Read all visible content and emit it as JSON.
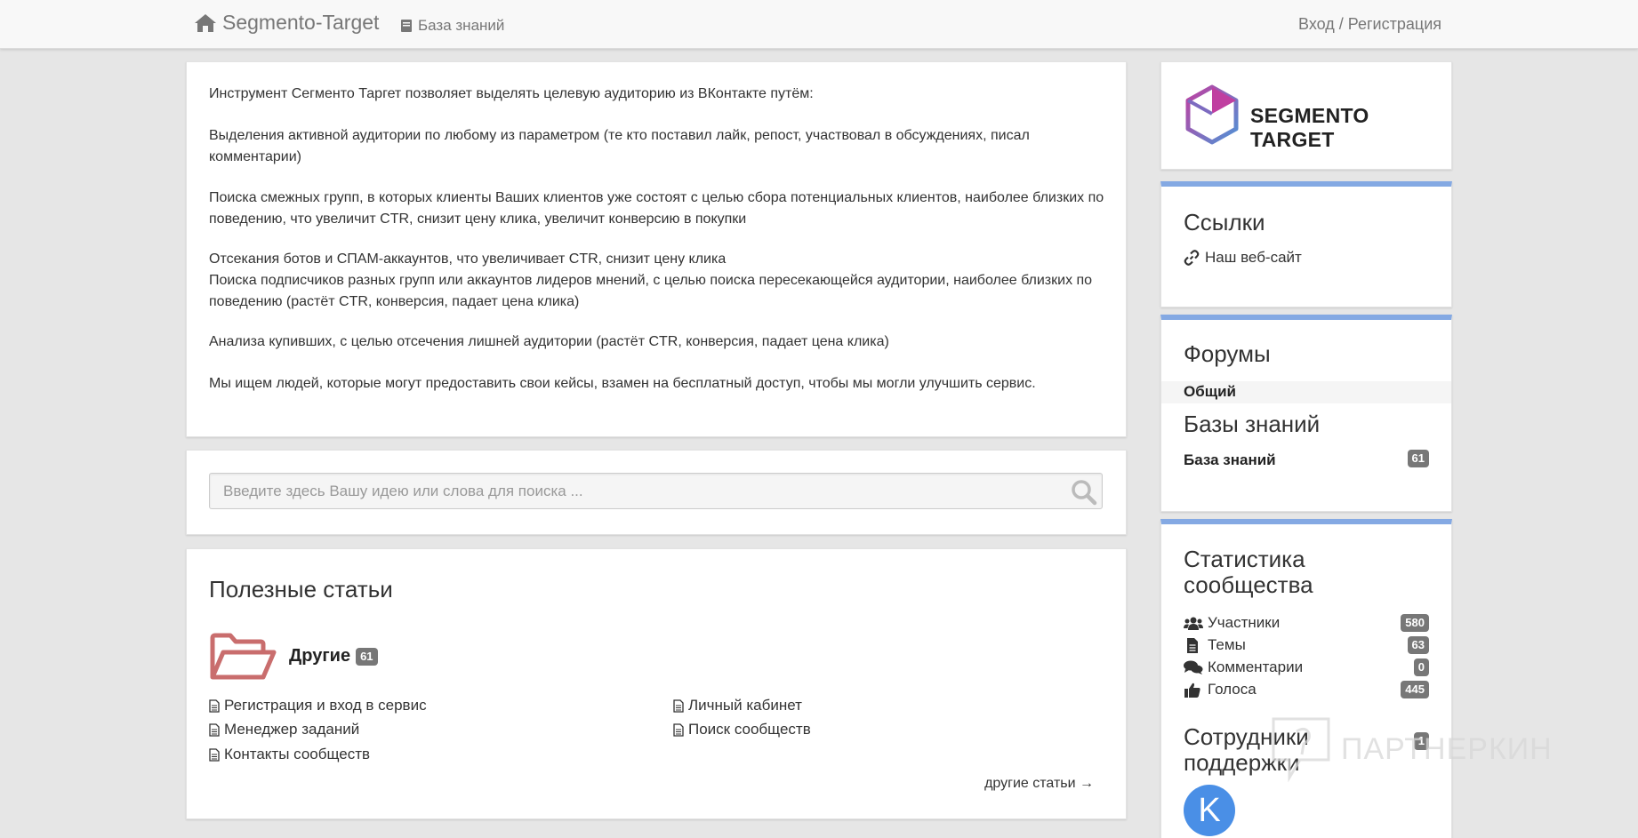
{
  "nav": {
    "brand": "Segmento-Target",
    "kb_link": "База знаний",
    "login": "Вход / Регистрация"
  },
  "intro": {
    "p1": "Инструмент Сегменто Таргет позволяет выделять целевую аудиторию из ВКонтакте путём:",
    "p2": "Выделения активной аудитории по любому из параметром (те кто поставил лайк, репост, участвовал в обсуждениях, писал комментарии)",
    "p3": "Поиска смежных групп, в которых клиенты Ваших клиентов уже состоят с целью сбора потенциальных клиентов, наиболее близких по поведению, что увеличит CTR, снизит цену клика, увеличит конверсию в покупки",
    "p4": "Отсекания ботов и СПАМ-аккаунтов, что увеличивает CTR, снизит цену клика",
    "p5": "Поиска подписчиков разных групп или аккаунтов лидеров мнений, с целью поиска пересекающейся аудитории,  наиболее близких по поведению (растёт CTR, конверсия, падает цена клика)",
    "p6": "Анализа купивших, с целью отсечения лишней аудитории (растёт CTR, конверсия, падает цена клика)",
    "p7": "Мы ищем людей, которые могут предоставить свои кейсы, взамен на бесплатный доступ, чтобы мы могли улучшить сервис."
  },
  "search": {
    "placeholder": "Введите здесь Вашу идею или слова для поиска ..."
  },
  "articles": {
    "title": "Полезные статьи",
    "category": "Другие",
    "category_count": "61",
    "items": [
      "Регистрация и вход в сервис",
      "Менеджер заданий",
      "Контакты сообществ",
      "Личный кабинет",
      "Поиск сообществ"
    ],
    "more": "другие статьи →"
  },
  "sidebar": {
    "logo_text": "SEGMENTO TARGET",
    "links_title": "Ссылки",
    "site_link": "Наш веб-сайт",
    "forums_title": "Форумы",
    "forum_general": "Общий",
    "kb_title": "Базы знаний",
    "kb_item": "База знаний",
    "kb_count": "61",
    "stats_title_1": "Статистика",
    "stats_title_2": "сообщества",
    "stats": [
      {
        "label": "Участники",
        "count": "580",
        "icon": "users-icon"
      },
      {
        "label": "Темы",
        "count": "63",
        "icon": "file-icon"
      },
      {
        "label": "Комментарии",
        "count": "0",
        "icon": "comments-icon"
      },
      {
        "label": "Голоса",
        "count": "445",
        "icon": "thumbs-up-icon"
      }
    ],
    "staff_title_1": "Сотрудники",
    "staff_title_2": "поддержки",
    "staff_count": "1",
    "avatar_letter": "K"
  },
  "watermark": "ПАРТНЕРКИН",
  "colors": {
    "accent_border": "#84a9e3",
    "folder": "#c96d6d",
    "avatar": "#4a8fe6",
    "badge": "#777777"
  }
}
